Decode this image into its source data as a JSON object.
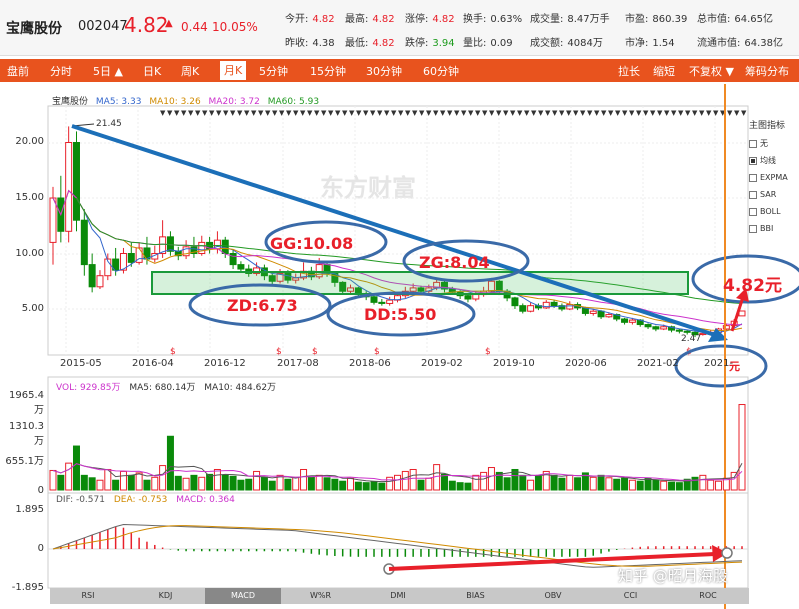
{
  "header": {
    "name": "宝鹰股份",
    "code": "002047",
    "price": "4.82",
    "arrow": "▲",
    "change": "0.44",
    "change_pct": "10.05%",
    "row1": [
      {
        "label": "今开:",
        "value": "4.82",
        "tone": "red"
      },
      {
        "label": "最高:",
        "value": "4.82",
        "tone": "red"
      },
      {
        "label": "涨停:",
        "value": "4.82",
        "tone": "red"
      },
      {
        "label": "换手:",
        "value": "0.63%",
        "tone": "plain"
      },
      {
        "label": "成交量:",
        "value": "8.47万手",
        "tone": "plain"
      },
      {
        "label": "市盈:",
        "value": "860.39",
        "tone": "plain"
      },
      {
        "label": "总市值:",
        "value": "64.65亿",
        "tone": "plain"
      }
    ],
    "row2": [
      {
        "label": "昨收:",
        "value": "4.38",
        "tone": "plain"
      },
      {
        "label": "最低:",
        "value": "4.82",
        "tone": "red"
      },
      {
        "label": "跌停:",
        "value": "3.94",
        "tone": "green"
      },
      {
        "label": "量比:",
        "value": "0.09",
        "tone": "plain"
      },
      {
        "label": "成交额:",
        "value": "4084万",
        "tone": "plain"
      },
      {
        "label": "市净:",
        "value": "1.54",
        "tone": "plain"
      },
      {
        "label": "流通市值:",
        "value": "64.38亿",
        "tone": "plain"
      }
    ]
  },
  "toolbar": {
    "left": [
      "盘前",
      "分时",
      "5日 ▲",
      "日K",
      "周K",
      "月K",
      "5分钟",
      "15分钟",
      "30分钟",
      "60分钟"
    ],
    "active": "月K",
    "right": [
      "拉长",
      "缩短",
      "不复权 ▼",
      "筹码分布"
    ]
  },
  "legend_main": {
    "name": "宝鹰股份",
    "ma5": "MA5: 3.33",
    "ma10": "MA10: 3.26",
    "ma20": "MA20: 3.72",
    "ma60": "MA60: 5.93"
  },
  "legend_vol": {
    "vol": "VOL: 929.85万",
    "ma5": "MA5: 680.14万",
    "ma10": "MA10: 484.62万"
  },
  "legend_macd": {
    "dif": "DIF: -0.571",
    "dea": "DEA: -0.753",
    "macd": "MACD: 0.364"
  },
  "yaxis_main": [
    "20.00",
    "15.00",
    "10.00",
    "5.00"
  ],
  "yaxis_vol": [
    "1965.4万",
    "1310.3万",
    "655.1万",
    "0"
  ],
  "yaxis_macd": [
    "1.895",
    "0",
    "-1.895"
  ],
  "xaxis": [
    "2015-05",
    "2016-04",
    "2016-12",
    "2017-08",
    "2018-06",
    "2019-02",
    "2019-10",
    "2020-06",
    "2021-02",
    "2021-"
  ],
  "markers": {
    "high": "21.45",
    "low": "2.47"
  },
  "right_panel": {
    "title": "主图指标",
    "items": [
      {
        "label": "无",
        "checked": false
      },
      {
        "label": "均线",
        "checked": true
      },
      {
        "label": "EXPMA",
        "checked": false
      },
      {
        "label": "SAR",
        "checked": false
      },
      {
        "label": "BOLL",
        "checked": false
      },
      {
        "label": "BBI",
        "checked": false
      }
    ]
  },
  "annotations": {
    "gg": "GG:10.08",
    "zg": "ZG:8.04",
    "zd": "ZD:6.73",
    "dd": "DD:5.50",
    "target": "4.82元",
    "low_label": "元"
  },
  "bottom_tabs": [
    "RSI",
    "KDJ",
    "MACD",
    "W%R",
    "DMI",
    "BIAS",
    "OBV",
    "CCI",
    "ROC"
  ],
  "bottom_active": "MACD",
  "watermark": "知乎 @昭月海股",
  "brand": "东方财富",
  "colors": {
    "up": "#e8202a",
    "down": "#0a8a0a",
    "accent": "#e8531e",
    "arrow_blue": "#1c6fb8",
    "ellipse": "#3a6aa8"
  }
}
